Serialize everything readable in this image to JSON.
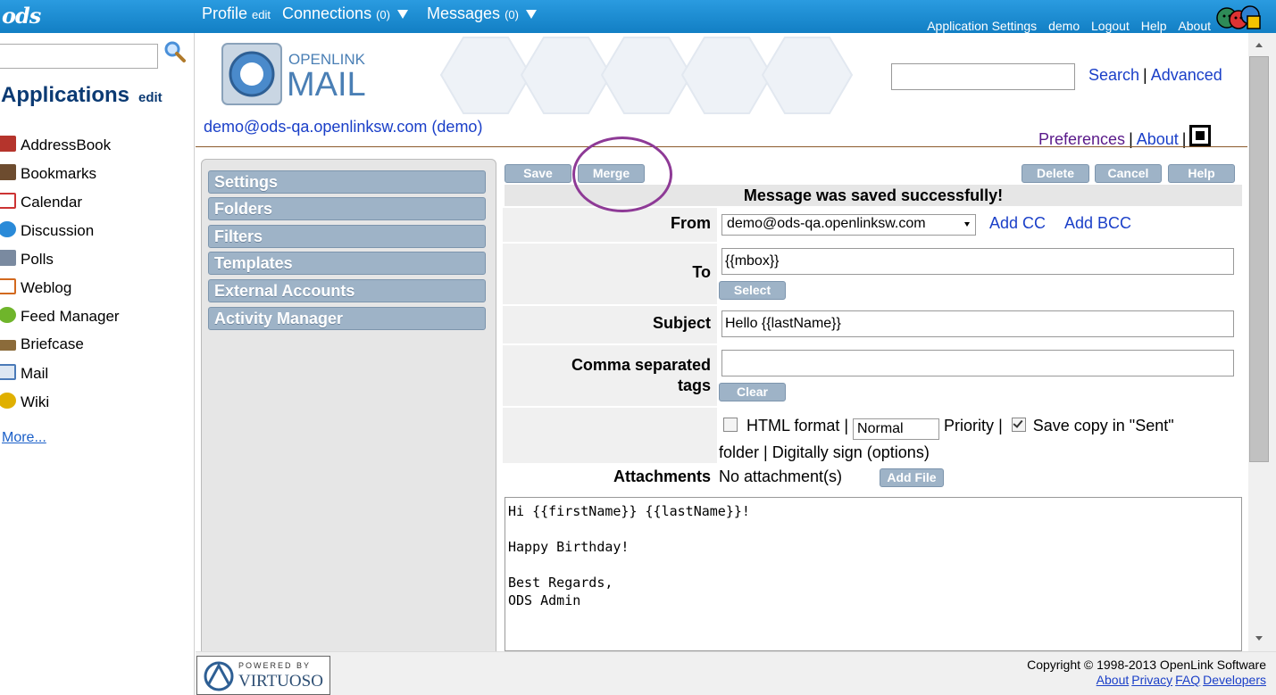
{
  "topbar": {
    "logo": "ods",
    "profile_label": "Profile",
    "profile_edit": "edit",
    "connections_label": "Connections",
    "connections_count": "(0)",
    "messages_label": "Messages",
    "messages_count": "(0)",
    "links": [
      "Application Settings",
      "demo",
      "Logout",
      "Help",
      "About"
    ]
  },
  "sidebar": {
    "search_placeholder": "",
    "title": "Applications",
    "edit": "edit",
    "items": [
      {
        "label": "AddressBook",
        "icon": "addressbook-icon",
        "color": "#b5342c"
      },
      {
        "label": "Bookmarks",
        "icon": "bookmarks-icon",
        "color": "#6d4c2f"
      },
      {
        "label": "Calendar",
        "icon": "calendar-icon",
        "color": "#c33"
      },
      {
        "label": "Discussion",
        "icon": "discussion-icon",
        "color": "#2a8ad8"
      },
      {
        "label": "Polls",
        "icon": "polls-icon",
        "color": "#7a8aa0"
      },
      {
        "label": "Weblog",
        "icon": "weblog-icon",
        "color": "#d2691e"
      },
      {
        "label": "Feed Manager",
        "icon": "feed-icon",
        "color": "#6fb52b"
      },
      {
        "label": "Briefcase",
        "icon": "briefcase-icon",
        "color": "#8b6b3a"
      },
      {
        "label": "Mail",
        "icon": "mail-icon",
        "color": "#4a7ab8"
      },
      {
        "label": "Wiki",
        "icon": "wiki-icon",
        "color": "#e0b000"
      }
    ],
    "more": "More..."
  },
  "header": {
    "logo_top": "OPENLINK",
    "logo_bottom": "MAIL",
    "search_link": "Search",
    "advanced_link": "Advanced",
    "account_email": "demo@ods-qa.openlinksw.com",
    "account_user": "(demo)",
    "preferences": "Preferences",
    "about": "About"
  },
  "settings_menu": [
    "Settings",
    "Folders",
    "Filters",
    "Templates",
    "External Accounts",
    "Activity Manager"
  ],
  "toolbar": {
    "save": "Save",
    "merge": "Merge",
    "delete": "Delete",
    "cancel": "Cancel",
    "help": "Help"
  },
  "status_message": "Message was saved successfully!",
  "form": {
    "from_label": "From",
    "from_value": "demo@ods-qa.openlinksw.com",
    "add_cc": "Add CC",
    "add_bcc": "Add BCC",
    "to_label": "To",
    "to_value": "{{mbox}}",
    "select_button": "Select",
    "subject_label": "Subject",
    "subject_value": "Hello {{lastName}}",
    "tags_label_1": "Comma separated",
    "tags_label_2": "tags",
    "tags_value": "",
    "clear_button": "Clear",
    "html_format": "HTML format",
    "priority_value": "Normal",
    "priority_label": "Priority",
    "save_copy": "Save copy in \"Sent\"",
    "folder_text": "folder",
    "digitally_sign": "Digitally sign",
    "options": "(options)",
    "html_checked": false,
    "save_copy_checked": true,
    "attachments_label": "Attachments",
    "attachments_value": "No attachment(s)",
    "add_file_button": "Add File",
    "body": "Hi {{firstName}} {{lastName}}!\n\nHappy Birthday!\n\nBest Regards,\nODS Admin"
  },
  "footer": {
    "powered_by": "POWERED BY",
    "virtuoso": "VIRTUOSO",
    "copyright": "Copyright © 1998-2013 OpenLink Software",
    "links": [
      "About",
      "Privacy",
      "FAQ",
      "Developers"
    ]
  }
}
